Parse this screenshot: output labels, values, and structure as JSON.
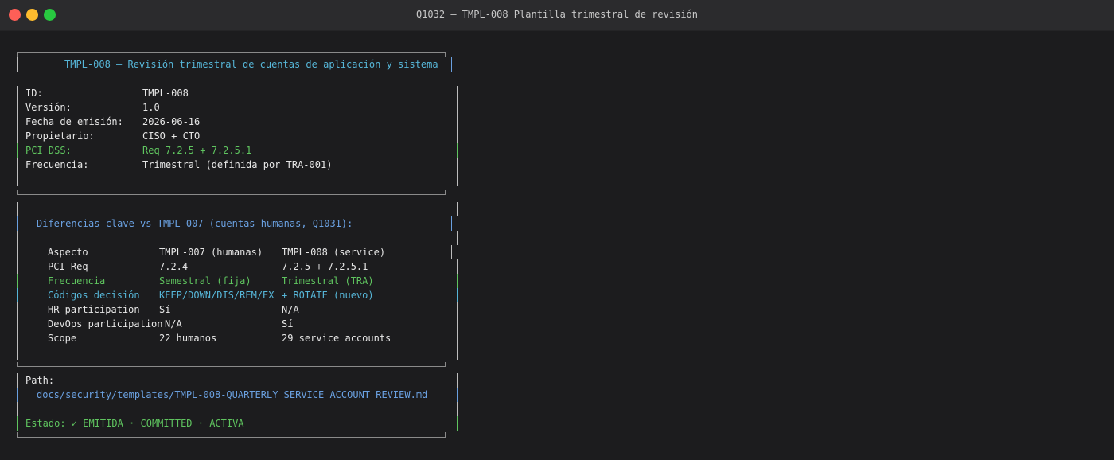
{
  "window": {
    "title": "Q1032 — TMPL-008 Plantilla trimestral de revisión"
  },
  "doc": {
    "header": "TMPL-008 — Revisión trimestral de cuentas de aplicación y sistema",
    "meta": [
      {
        "label": "ID:",
        "value": "TMPL-008"
      },
      {
        "label": "Versión:",
        "value": "1.0"
      },
      {
        "label": "Fecha de emisión:",
        "value": "2026-06-16"
      },
      {
        "label": "Propietario:",
        "value": "CISO + CTO"
      },
      {
        "label": "PCI DSS:",
        "value": "Req 7.2.5 + 7.2.5.1"
      },
      {
        "label": "Frecuencia:",
        "value": "Trimestral (definida por TRA-001)"
      }
    ],
    "diff_title": "Diferencias clave vs TMPL-007 (cuentas humanas, Q1031):",
    "table": {
      "headers": [
        "Aspecto",
        "TMPL-007 (humanas)",
        "TMPL-008 (service)"
      ],
      "rows": [
        [
          "PCI Req",
          "7.2.4",
          "7.2.5 + 7.2.5.1"
        ],
        [
          "Frecuencia",
          "Semestral (fija)",
          "Trimestral (TRA)"
        ],
        [
          "Códigos decisión",
          "KEEP/DOWN/DIS/REM/EX",
          "+ ROTATE (nuevo)"
        ],
        [
          "HR participation",
          "Sí",
          "N/A"
        ],
        [
          "DevOps participation",
          "N/A",
          "Sí"
        ],
        [
          "Scope",
          "22 humanos",
          "29 service accounts"
        ]
      ]
    },
    "path_label": "Path:",
    "path": "docs/security/templates/TMPL-008-QUARTERLY_SERVICE_ACCOUNT_REVIEW.md",
    "status": "Estado: ✓ EMITIDA · COMMITTED · ACTIVA"
  },
  "colors": {
    "cyan": "#56b6d8",
    "green": "#5fc45f",
    "blue": "#6aa0e0"
  }
}
